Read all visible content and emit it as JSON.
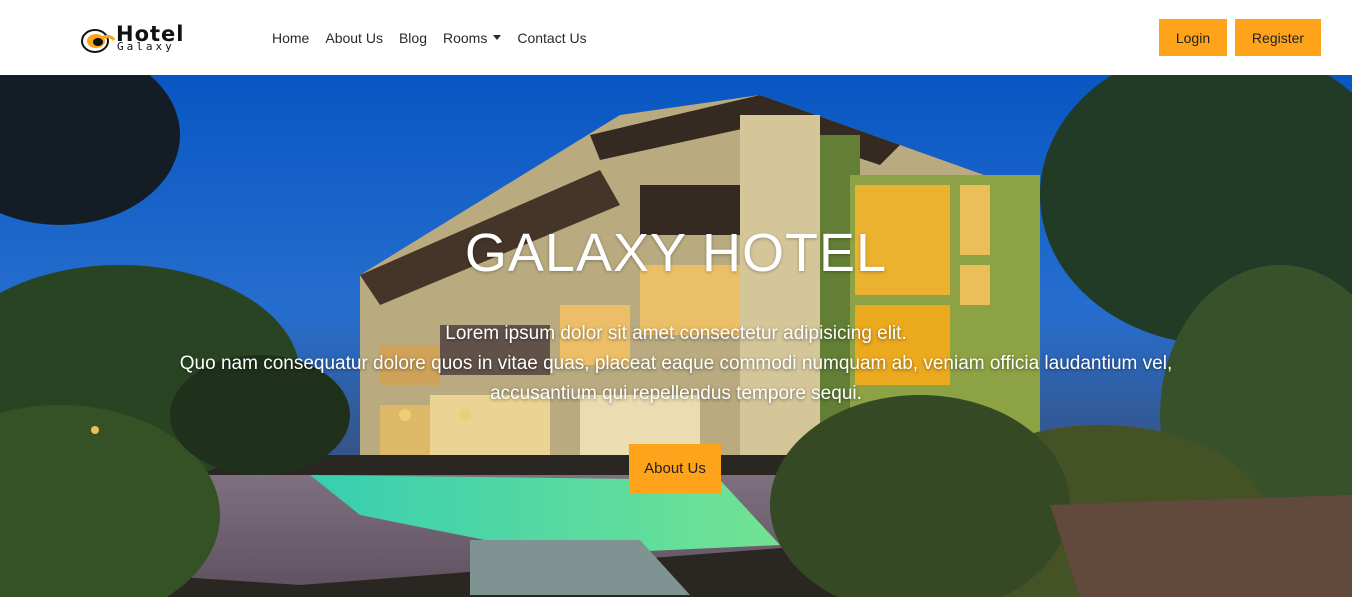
{
  "brand": {
    "title": "Hotel",
    "subtitle": "Galaxy",
    "icon": "hotel-logo-swirl-icon",
    "accent": "#ffa31a"
  },
  "nav": {
    "items": [
      {
        "label": "Home"
      },
      {
        "label": "About Us"
      },
      {
        "label": "Blog"
      },
      {
        "label": "Rooms",
        "dropdown": true
      },
      {
        "label": "Contact Us"
      }
    ]
  },
  "auth": {
    "login_label": "Login",
    "register_label": "Register"
  },
  "hero": {
    "title": "GALAXY HOTEL",
    "lines": [
      "Lorem ipsum dolor sit amet consectetur adipisicing elit.",
      "Quo nam consequatur dolore quos in vitae quas, placeat eaque commodi numquam ab, veniam officia laudantium vel,",
      "accusantium qui repellendus tempore sequi."
    ],
    "button_label": "About Us"
  }
}
